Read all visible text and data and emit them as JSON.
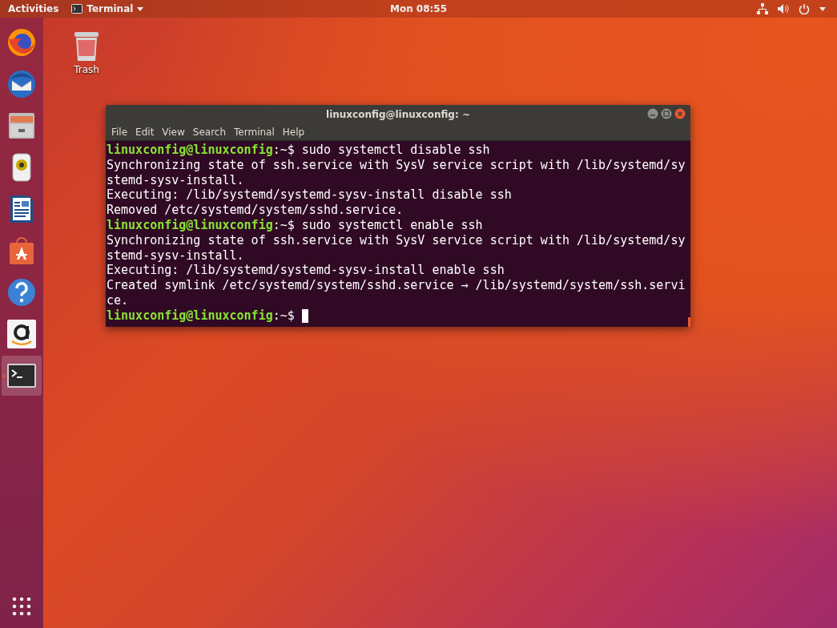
{
  "top_bar": {
    "activities": "Activities",
    "app_menu": "Terminal",
    "clock": "Mon 08:55"
  },
  "dock": {
    "items": [
      {
        "kind": "firefox",
        "selected": false
      },
      {
        "kind": "mail",
        "selected": false
      },
      {
        "kind": "files",
        "selected": false
      },
      {
        "kind": "music",
        "selected": false
      },
      {
        "kind": "writer",
        "selected": false
      },
      {
        "kind": "software",
        "selected": false
      },
      {
        "kind": "help",
        "selected": false
      },
      {
        "kind": "amazon",
        "selected": false
      },
      {
        "kind": "terminal",
        "selected": true
      }
    ]
  },
  "desktop_icons": [
    {
      "label": "Trash"
    }
  ],
  "window": {
    "title": "linuxconfig@linuxconfig: ~",
    "menu": [
      "File",
      "Edit",
      "View",
      "Search",
      "Terminal",
      "Help"
    ],
    "lines": [
      {
        "kind": "prompt",
        "user": "linuxconfig@linuxconfig",
        "path": ":~$",
        "command": "sudo systemctl disable ssh"
      },
      {
        "kind": "output",
        "text": "Synchronizing state of ssh.service with SysV service script with /lib/systemd/sy"
      },
      {
        "kind": "output",
        "text": "stemd-sysv-install."
      },
      {
        "kind": "output",
        "text": "Executing: /lib/systemd/systemd-sysv-install disable ssh"
      },
      {
        "kind": "output",
        "text": "Removed /etc/systemd/system/sshd.service."
      },
      {
        "kind": "prompt",
        "user": "linuxconfig@linuxconfig",
        "path": ":~$",
        "command": "sudo systemctl enable ssh"
      },
      {
        "kind": "output",
        "text": "Synchronizing state of ssh.service with SysV service script with /lib/systemd/sy"
      },
      {
        "kind": "output",
        "text": "stemd-sysv-install."
      },
      {
        "kind": "output",
        "text": "Executing: /lib/systemd/systemd-sysv-install enable ssh"
      },
      {
        "kind": "output",
        "text": "Created symlink /etc/systemd/system/sshd.service → /lib/systemd/system/ssh.servi"
      },
      {
        "kind": "output",
        "text": "ce."
      },
      {
        "kind": "prompt",
        "user": "linuxconfig@linuxconfig",
        "path": ":~$",
        "cursor": true
      }
    ]
  }
}
